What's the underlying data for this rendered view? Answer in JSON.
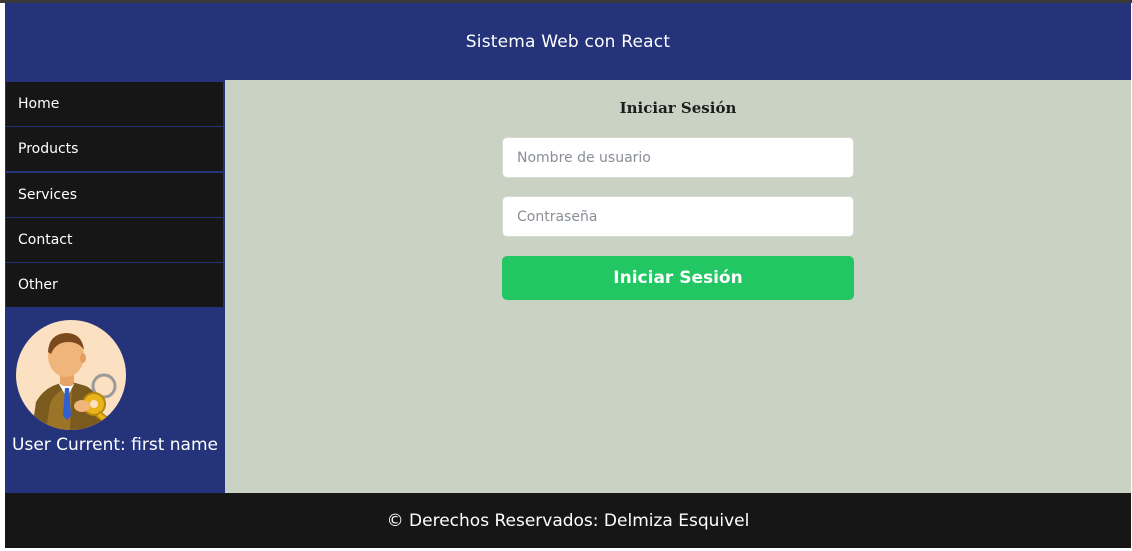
{
  "header": {
    "title": "Sistema Web con React"
  },
  "sidebar": {
    "items": [
      {
        "label": "Home"
      },
      {
        "label": "Products"
      },
      {
        "label": "Services"
      },
      {
        "label": "Contact"
      },
      {
        "label": "Other"
      }
    ],
    "avatar_icon": "user-with-key-icon",
    "user_label": "User Current: first name"
  },
  "login": {
    "title": "Iniciar Sesión",
    "username_placeholder": "Nombre de usuario",
    "username_value": "",
    "password_placeholder": "Contraseña",
    "password_value": "",
    "submit_label": "Iniciar Sesión"
  },
  "footer": {
    "text": "© Derechos Reservados: Delmiza Esquivel"
  },
  "colors": {
    "header_bg": "#25347a",
    "nav_bg": "#161616",
    "main_bg": "#c9d2c3",
    "button_bg": "#22c763",
    "footer_bg": "#161616"
  }
}
